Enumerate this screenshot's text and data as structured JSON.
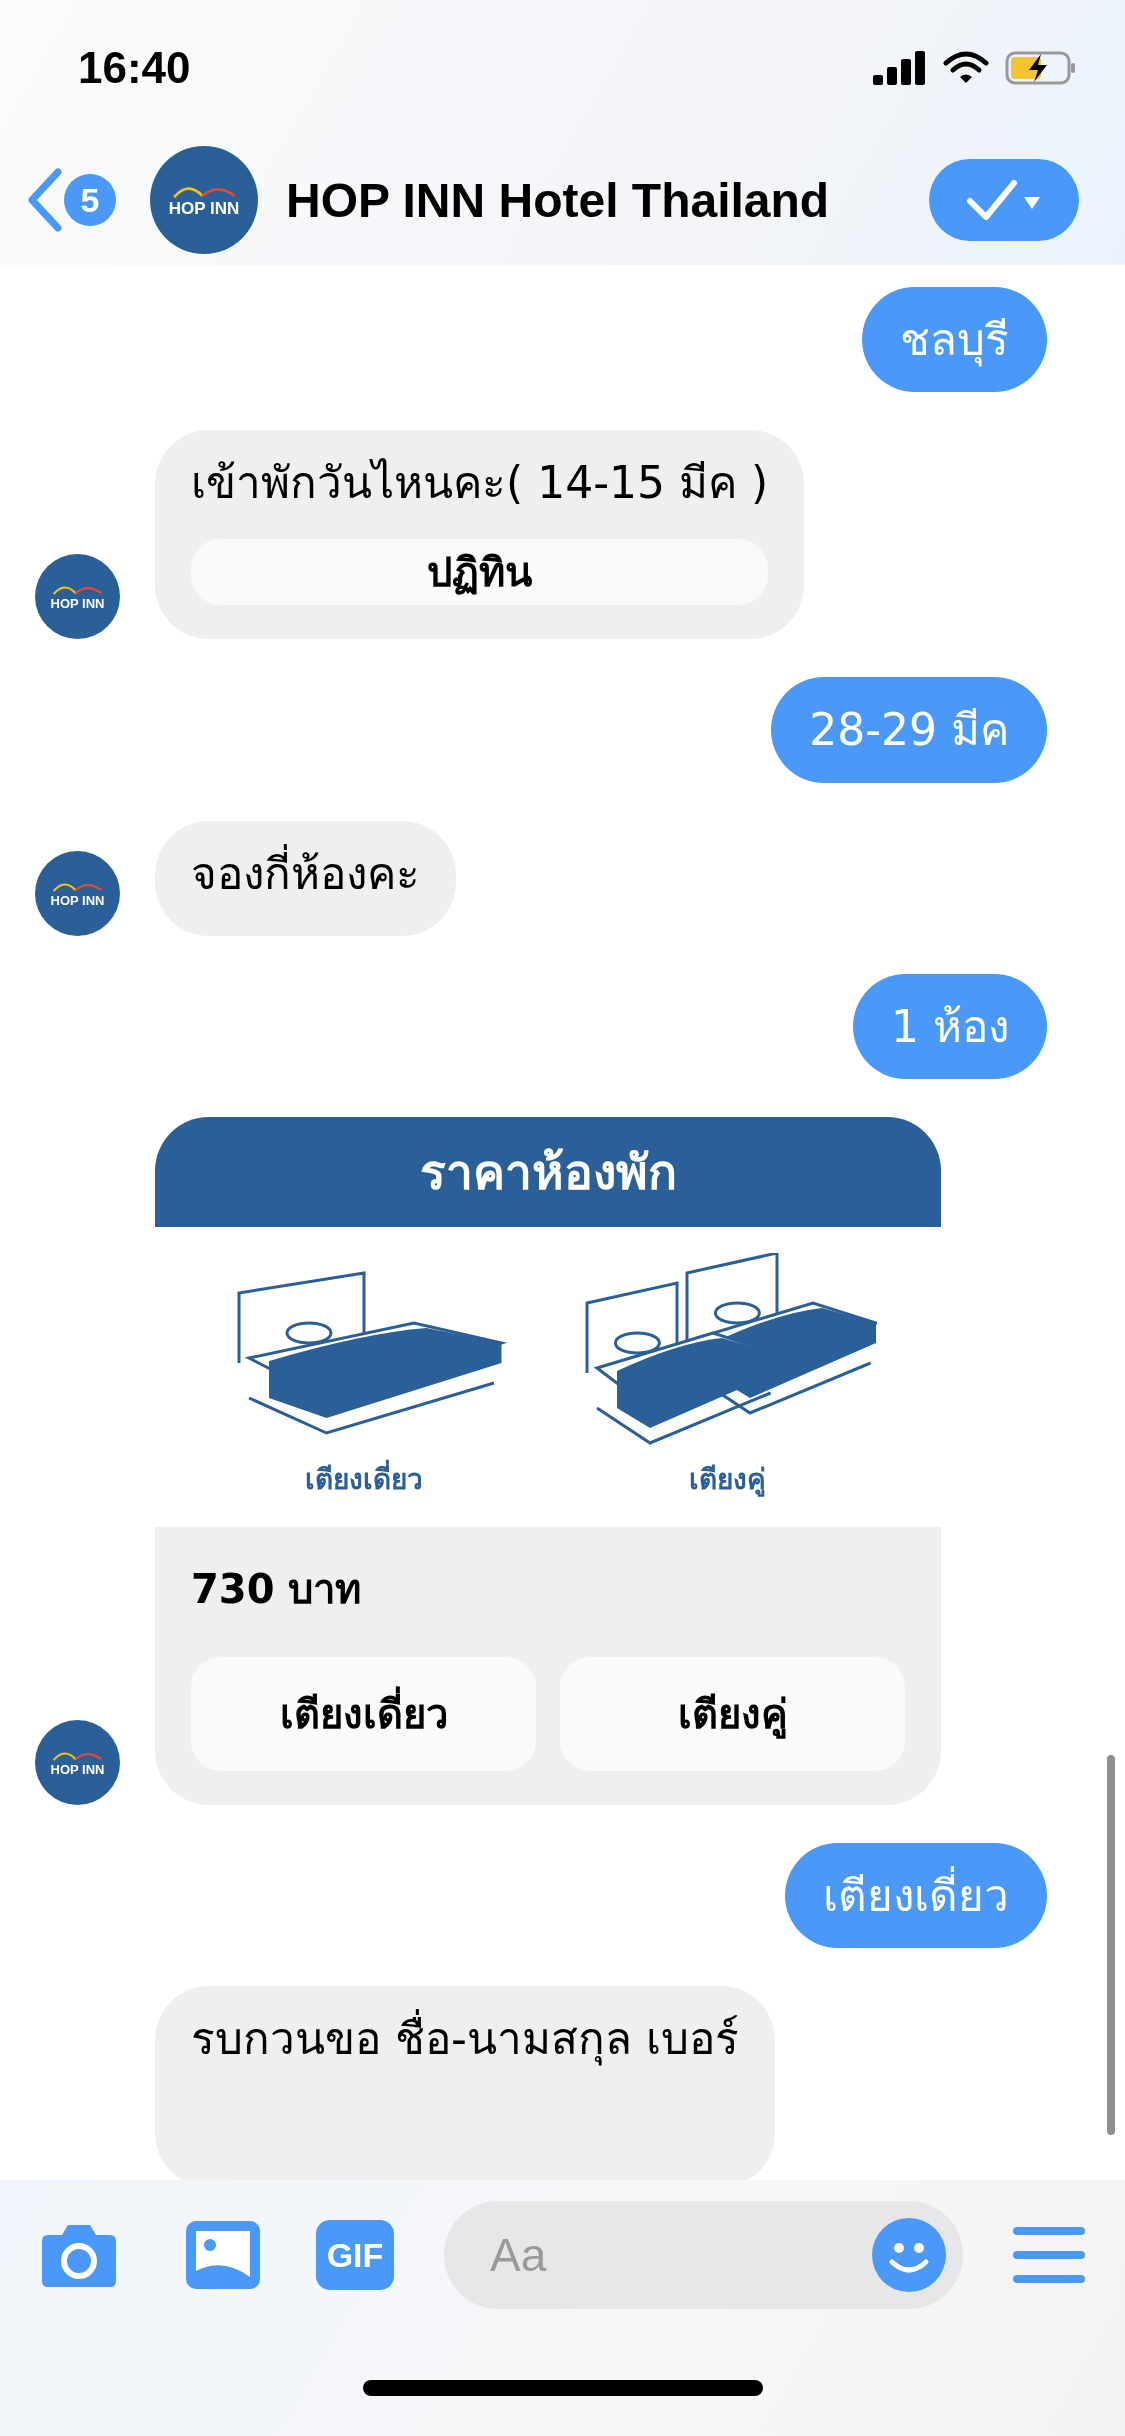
{
  "status_bar": {
    "time": "16:40"
  },
  "header": {
    "back_count": "5",
    "avatar_text": "HOP INN",
    "title": "HOP INN Hotel Thailand"
  },
  "messages": [
    {
      "kind": "outgoing",
      "text": "ชลบุรี"
    },
    {
      "kind": "incoming",
      "avatar_text": "HOP INN",
      "text": "เข้าพักวันไหนคะ( 14-15 มีค )",
      "buttons": [
        "ปฏิทิน"
      ]
    },
    {
      "kind": "outgoing",
      "text": "28-29 มีค"
    },
    {
      "kind": "incoming",
      "avatar_text": "HOP INN",
      "text": "จองกี่ห้องคะ"
    },
    {
      "kind": "outgoing",
      "text": "1 ห้อง"
    },
    {
      "kind": "card",
      "avatar_text": "HOP INN",
      "title": "ราคาห้องพัก",
      "options": [
        {
          "kind": "single",
          "caption": "เตียงเดี่ยว"
        },
        {
          "kind": "twin",
          "caption": "เตียงคู่"
        }
      ],
      "price": "730 บาท",
      "buttons": [
        "เตียงเดี่ยว",
        "เตียงคู่"
      ]
    },
    {
      "kind": "outgoing",
      "text": "เตียงเดี่ยว"
    },
    {
      "kind": "incoming",
      "text": "รบกวนขอ ชื่อ-นามสกุล เบอร์"
    }
  ],
  "composer": {
    "gif_label": "GIF",
    "placeholder": "Aa"
  }
}
